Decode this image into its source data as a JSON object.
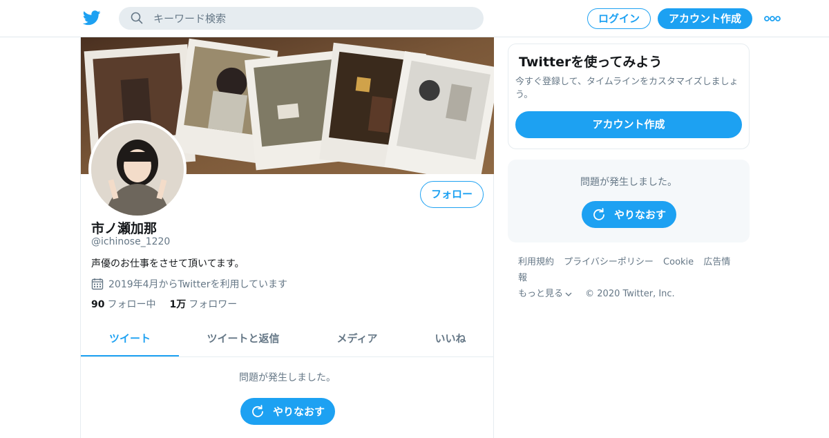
{
  "topbar": {
    "search_placeholder": "キーワード検索",
    "login_label": "ログイン",
    "signup_label": "アカウント作成"
  },
  "profile": {
    "name": "市ノ瀬加那",
    "handle": "@ichinose_1220",
    "bio": "声優のお仕事をさせて頂いてます。",
    "joined": "2019年4月からTwitterを利用しています",
    "following_count": "90",
    "following_label": "フォロー中",
    "followers_count": "1万",
    "followers_label": "フォロワー",
    "follow_button": "フォロー"
  },
  "tabs": [
    {
      "label": "ツイート",
      "active": true
    },
    {
      "label": "ツイートと返信",
      "active": false
    },
    {
      "label": "メディア",
      "active": false
    },
    {
      "label": "いいね",
      "active": false
    }
  ],
  "timeline": {
    "error_message": "問題が発生しました。",
    "retry_label": "やりなおす"
  },
  "signup_card": {
    "title": "Twitterを使ってみよう",
    "description": "今すぐ登録して、タイムラインをカスタマイズしましょう。",
    "cta": "アカウント作成"
  },
  "error_card": {
    "message": "問題が発生しました。",
    "retry_label": "やりなおす"
  },
  "footer": {
    "links": [
      "利用規約",
      "プライバシーポリシー",
      "Cookie",
      "広告情報"
    ],
    "more_label": "もっと見る",
    "copyright": "© 2020 Twitter, Inc."
  },
  "colors": {
    "accent": "#1da1f2",
    "muted": "#657786",
    "border": "#e6ecf0"
  }
}
